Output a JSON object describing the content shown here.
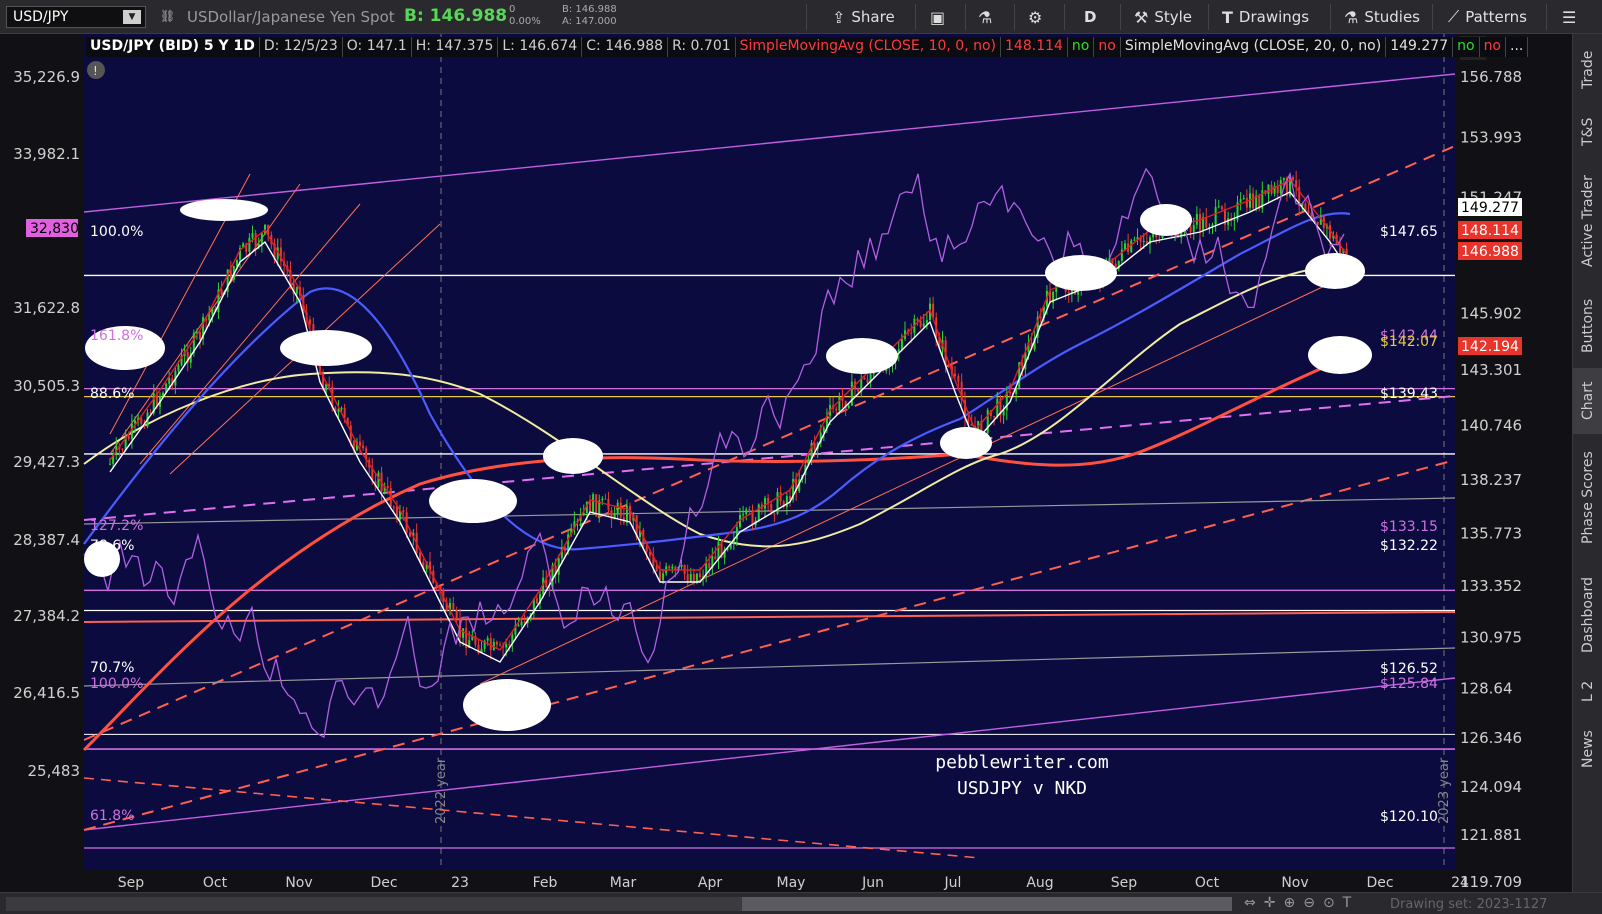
{
  "toolbar": {
    "symbol": "USD/JPY",
    "symbol_caret": "▼",
    "link_icon": "link-icon",
    "description": "USDollar/Japanese Yen Spot",
    "bid": "B: 146.988",
    "change": "0",
    "change_pct": "0.00%",
    "bid_small": "B: 146.988",
    "ask_small": "A: 147.000",
    "share": "Share",
    "drawings": "Drawings",
    "style": "Style",
    "studies": "Studies",
    "patterns": "Patterns",
    "aggregation": "D"
  },
  "legend": {
    "title": "USD/JPY (BID) 5 Y 1D",
    "date": "D: 12/5/23",
    "open": "O: 147.1",
    "high": "H: 147.375",
    "low": "L: 146.674",
    "close": "C: 146.988",
    "range": "R: 0.701",
    "sma10": "SimpleMovingAvg (CLOSE, 10, 0, no)",
    "sma10_val": "148.114",
    "no1": "no",
    "no2": "no",
    "sma20": "SimpleMovingAvg (CLOSE, 20, 0, no)",
    "sma20_val": "149.277",
    "no3": "no",
    "no4": "no",
    "more": "..."
  },
  "chart_data": {
    "type": "line",
    "title": "USD/JPY (BID) 5 Y 1D",
    "annotation_lines": [
      "pebblewriter.com",
      "USDJPY v NKD"
    ],
    "right_axis_ticks": [
      "156.788",
      "153.993",
      "151.247",
      "145.902",
      "143.301",
      "140.746",
      "138.237",
      "135.773",
      "133.352",
      "130.975",
      "128.64",
      "126.346",
      "124.094",
      "121.881",
      "119.709"
    ],
    "left_axis_ticks": [
      "35,226.9",
      "33,982.1",
      "31,622.8",
      "30,505.3",
      "29,427.3",
      "28,387.4",
      "27,384.2",
      "26,416.5",
      "25,483"
    ],
    "x_ticks": [
      "Sep",
      "Oct",
      "Nov",
      "Dec",
      "23",
      "Feb",
      "Mar",
      "Apr",
      "May",
      "Jun",
      "Jul",
      "Aug",
      "Sep",
      "Oct",
      "Nov",
      "Dec",
      "24"
    ],
    "year_markers": [
      "2022 year",
      "2023 year"
    ],
    "price_labels": [
      {
        "text": "149.277",
        "color": "#ffffff",
        "fg": "#000000"
      },
      {
        "text": "148.114",
        "color": "#e8342b",
        "fg": "#ffffff"
      },
      {
        "text": "146.988",
        "color": "#e8342b",
        "fg": "#ffffff"
      },
      {
        "text": "142.194",
        "color": "#e8342b",
        "fg": "#ffffff"
      }
    ],
    "left_badge": "32,830",
    "fib_labels_left": [
      {
        "text": "100.0%",
        "color": "#ffffff"
      },
      {
        "text": "161.8%",
        "color": "#d070e0"
      },
      {
        "text": "88.6%",
        "color": "#ffffff"
      },
      {
        "text": "127.2%",
        "color": "#d070e0"
      },
      {
        "text": "78.6%",
        "color": "#ffffff"
      },
      {
        "text": "70.7%",
        "color": "#ffffff"
      },
      {
        "text": "100.0%",
        "color": "#d070e0"
      },
      {
        "text": "61.8%",
        "color": "#d070e0"
      }
    ],
    "level_labels_right": [
      {
        "text": "$147.65",
        "color": "#ffffff"
      },
      {
        "text": "$142.44",
        "color": "#d070e0"
      },
      {
        "text": "$142.07",
        "color": "#e8c840"
      },
      {
        "text": "$139.43",
        "color": "#ffffff"
      },
      {
        "text": "$133.15",
        "color": "#d070e0"
      },
      {
        "text": "$132.22",
        "color": "#ffffff"
      },
      {
        "text": "$126.52",
        "color": "#ffffff"
      },
      {
        "text": "$125.84",
        "color": "#d070e0"
      },
      {
        "text": "$120.10",
        "color": "#ffffff"
      }
    ]
  },
  "side_tabs": [
    "Trade",
    "T&S",
    "Active Trader",
    "Buttons",
    "Chart",
    "Phase Scores",
    "Dashboard",
    "L 2",
    "News"
  ],
  "bottom": {
    "drawing_set": "Drawing set: 2023-1127"
  },
  "colors": {
    "plot_bg": "#0b0b3f",
    "candle_up": "#2bd42b",
    "candle_down": "#e83a2b",
    "sma_white": "#ffffff",
    "sma_blue": "#4a5cff",
    "sma_yellow": "#f0eca0",
    "sma_red_thick": "#ff5040",
    "nikkei_purple": "#b060e0"
  }
}
